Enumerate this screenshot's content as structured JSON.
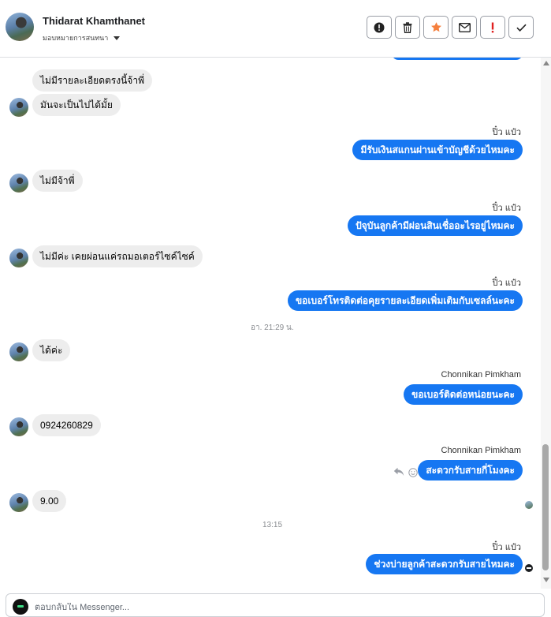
{
  "header": {
    "contact_name": "Thidarat Khamthanet",
    "assign_label": "มอบหมายการสนทนา",
    "actions": [
      {
        "name": "alert-circle-icon",
        "color": "#222222"
      },
      {
        "name": "trash-icon",
        "color": "#222222"
      },
      {
        "name": "star-icon",
        "color": "#f5803e"
      },
      {
        "name": "envelope-icon",
        "color": "#222222"
      },
      {
        "name": "exclamation-icon",
        "color": "#e02020"
      },
      {
        "name": "check-icon",
        "color": "#222222"
      }
    ]
  },
  "thread": {
    "messages": [
      {
        "dir": "in",
        "text": "ไม่มีรายละเอียดตรงนี้จ้าพี่",
        "avatar": false
      },
      {
        "dir": "in",
        "text": "มันจะเป็นไปได้มั้ย",
        "avatar": true
      },
      {
        "dir": "out",
        "sender": "ปิ๋ว แป๋ว",
        "text": "มีรับเงินสแกนผ่านเข้าบัญชีด้วยไหมคะ"
      },
      {
        "dir": "in",
        "text": "ไม่มีจ้าพี่",
        "avatar": true
      },
      {
        "dir": "out",
        "sender": "ปิ๋ว แป๋ว",
        "text": "ปัจุบันลูกค้ามีผ่อนสินเชื่ออะไรอยู่ไหมคะ"
      },
      {
        "dir": "in",
        "text": "ไม่มีค่ะ เคยผ่อนแค่รถมอเตอร์ไซค์ไซค์",
        "avatar": true
      },
      {
        "dir": "out",
        "sender": "ปิ๋ว แป๋ว",
        "text": "ขอเบอร์โทรติดต่อคุยรายละเอียดเพิ่มเติมกับเซลล์นะคะ"
      },
      {
        "dir": "time",
        "text": "อา. 21:29 น."
      },
      {
        "dir": "in",
        "text": "ได้ค่ะ",
        "avatar": true
      },
      {
        "dir": "out",
        "sender": "Chonnikan Pimkham",
        "text": "ขอเบอร์ติดต่อหน่อยนะคะ"
      },
      {
        "dir": "in",
        "text": "0924260829",
        "avatar": true
      },
      {
        "dir": "out",
        "sender": "Chonnikan Pimkham",
        "text": "สะดวกรับสายกี่โมงคะ"
      },
      {
        "dir": "in",
        "text": "9.00",
        "avatar": true
      },
      {
        "dir": "time",
        "text": "13:15"
      },
      {
        "dir": "out",
        "sender": "ปิ๋ว แป๋ว",
        "text": "ช่วงบ่ายลูกค้าสะดวกรับสายไหมคะ"
      }
    ]
  },
  "composer": {
    "placeholder": "ตอบกลับใน Messenger..."
  },
  "colors": {
    "outgoing_bubble": "#1677f2",
    "incoming_bubble": "#ededed"
  }
}
